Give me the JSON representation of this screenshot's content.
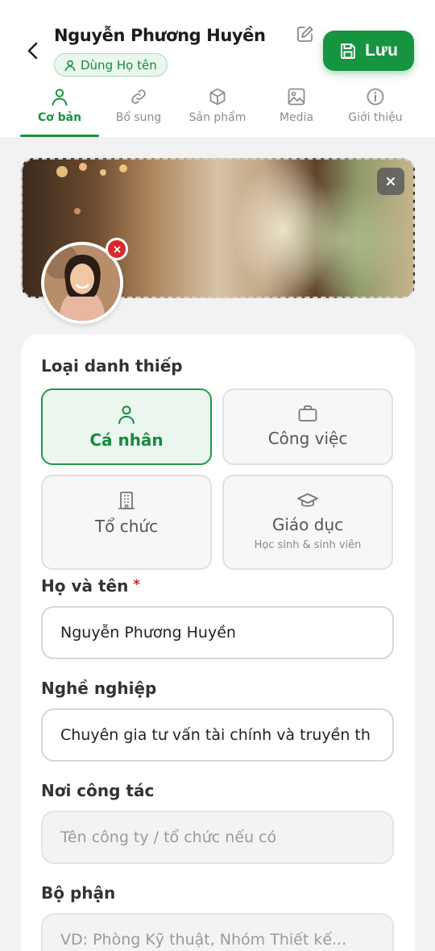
{
  "header": {
    "name": "Nguyễn Phương Huyền",
    "badge": "Dùng Họ tên",
    "save_label": "Lưu"
  },
  "tabs": [
    {
      "label": "Cơ bản",
      "icon": "person-icon",
      "active": true
    },
    {
      "label": "Bổ sung",
      "icon": "link-icon",
      "active": false
    },
    {
      "label": "Sản phẩm",
      "icon": "box-icon",
      "active": false
    },
    {
      "label": "Media",
      "icon": "image-icon",
      "active": false
    },
    {
      "label": "Giới thiệu",
      "icon": "info-icon",
      "active": false
    }
  ],
  "card_type": {
    "label": "Loại danh thiếp",
    "options": [
      {
        "title": "Cá nhân",
        "icon": "person-icon",
        "selected": true
      },
      {
        "title": "Công việc",
        "icon": "briefcase-icon",
        "selected": false
      },
      {
        "title": "Tổ chức",
        "icon": "building-icon",
        "selected": false
      },
      {
        "title": "Giáo dục",
        "subtitle": "Học sinh & sinh viên",
        "icon": "graduation-cap-icon",
        "selected": false
      }
    ]
  },
  "form": {
    "full_name": {
      "label": "Họ và tên",
      "required_mark": "*",
      "value": "Nguyễn Phương Huyền"
    },
    "occupation": {
      "label": "Nghề nghiệp",
      "value": "Chuyên gia tư vấn tài chính và truyền th"
    },
    "workplace": {
      "label": "Nơi công tác",
      "placeholder": "Tên công ty / tổ chức nếu có"
    },
    "department": {
      "label": "Bộ phận",
      "placeholder": "VD: Phòng Kỹ thuật, Nhóm Thiết kế..."
    }
  },
  "colors": {
    "accent": "#16943f",
    "danger": "#d92a2a"
  }
}
